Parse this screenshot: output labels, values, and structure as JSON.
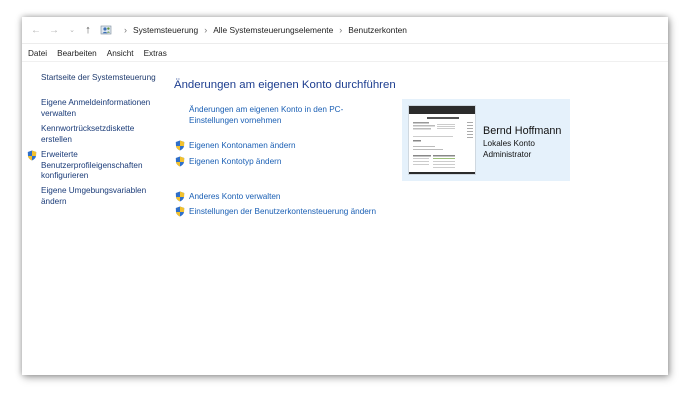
{
  "breadcrumb": {
    "items": [
      "Systemsteuerung",
      "Alle Systemsteuerungselemente",
      "Benutzerkonten"
    ]
  },
  "menu": [
    "Datei",
    "Bearbeiten",
    "Ansicht",
    "Extras"
  ],
  "sidebar": {
    "home": "Startseite der Systemsteuerung",
    "items": [
      "Eigene Anmeldeinformationen verwalten",
      "Kennwortrücksetzdiskette erstellen",
      "Erweiterte Benutzerprofileigenschaften konfigurieren",
      "Eigene Umgebungsvariablen ändern"
    ]
  },
  "main": {
    "title": "Änderungen am eigenen Konto durchführen",
    "pc_settings_link": "Änderungen am eigenen Konto in den PC-Einstellungen vornehmen",
    "rename_link": "Eigenen Kontonamen ändern",
    "type_link": "Eigenen Kontotyp ändern",
    "other_account_link": "Anderes Konto verwalten",
    "uac_link": "Einstellungen der Benutzerkontensteuerung ändern"
  },
  "account": {
    "name": "Bernd Hoffmann",
    "type": "Lokales Konto",
    "role": "Administrator"
  },
  "colors": {
    "link": "#1a5fb4",
    "title": "#1c3d8f",
    "card_bg": "#e5f1fb"
  }
}
